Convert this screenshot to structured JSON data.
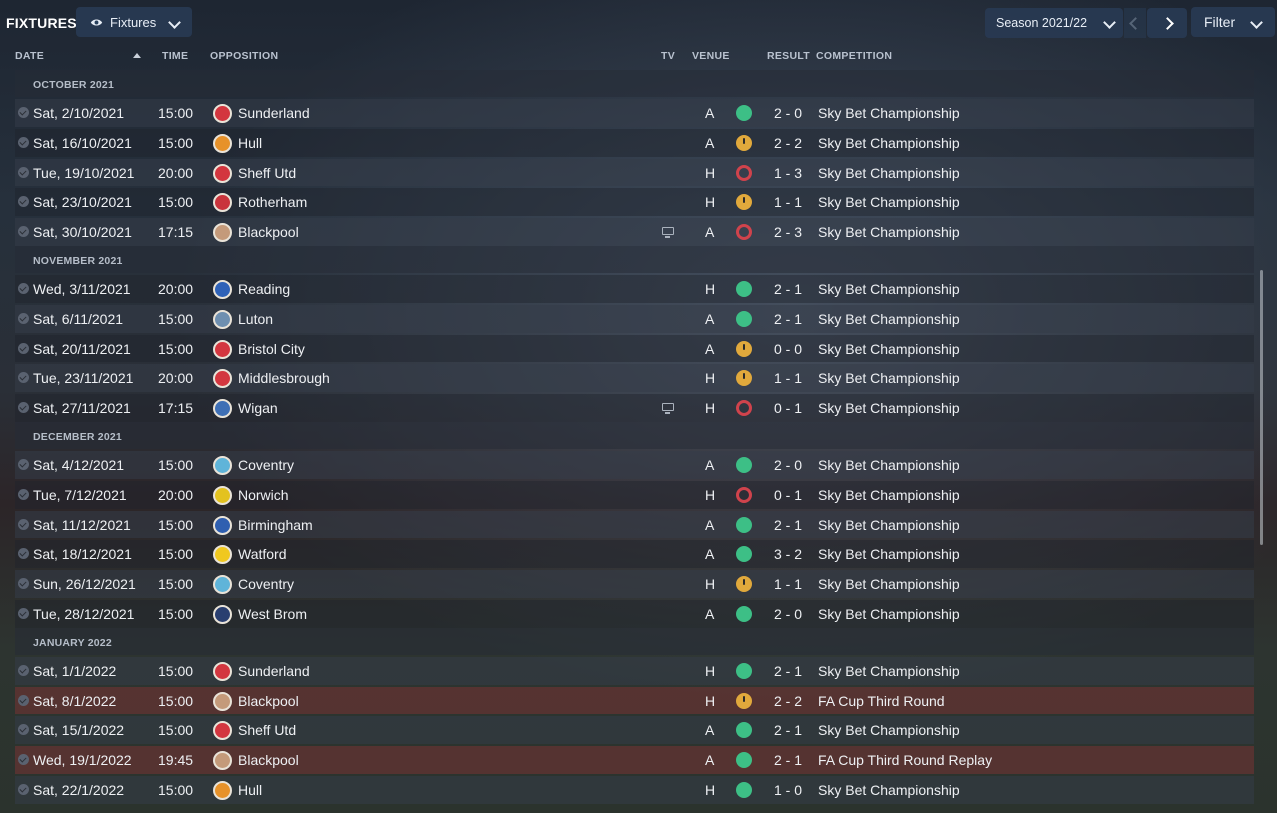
{
  "header": {
    "title": "FIXTURES",
    "view_button": "Fixtures",
    "season": "Season 2021/22",
    "filter": "Filter"
  },
  "columns": {
    "date": "DATE",
    "time": "TIME",
    "opposition": "OPPOSITION",
    "tv": "TV",
    "venue": "VENUE",
    "result": "RESULT",
    "competition": "COMPETITION"
  },
  "colors": {
    "win": "#3dbf86",
    "draw": "#e1a93c",
    "loss": "#d0434c",
    "cup_row": "#703434"
  },
  "groups": [
    {
      "month": "OCTOBER 2021",
      "fixtures": [
        {
          "date": "Sat, 2/10/2021",
          "time": "15:00",
          "opponent": "Sunderland",
          "badge_color": "#d3363f",
          "tv": false,
          "venue": "A",
          "outcome": "win",
          "result": "2 - 0",
          "competition": "Sky Bet Championship",
          "cup": false
        },
        {
          "date": "Sat, 16/10/2021",
          "time": "15:00",
          "opponent": "Hull",
          "badge_color": "#e7922a",
          "tv": false,
          "venue": "A",
          "outcome": "draw",
          "result": "2 - 2",
          "competition": "Sky Bet Championship",
          "cup": false
        },
        {
          "date": "Tue, 19/10/2021",
          "time": "20:00",
          "opponent": "Sheff Utd",
          "badge_color": "#d3363f",
          "tv": false,
          "venue": "H",
          "outcome": "loss",
          "result": "1 - 3",
          "competition": "Sky Bet Championship",
          "cup": false
        },
        {
          "date": "Sat, 23/10/2021",
          "time": "15:00",
          "opponent": "Rotherham",
          "badge_color": "#c9343c",
          "tv": false,
          "venue": "H",
          "outcome": "draw",
          "result": "1 - 1",
          "competition": "Sky Bet Championship",
          "cup": false
        },
        {
          "date": "Sat, 30/10/2021",
          "time": "17:15",
          "opponent": "Blackpool",
          "badge_color": "#c49a7a",
          "tv": true,
          "venue": "A",
          "outcome": "loss",
          "result": "2 - 3",
          "competition": "Sky Bet Championship",
          "cup": false
        }
      ]
    },
    {
      "month": "NOVEMBER 2021",
      "fixtures": [
        {
          "date": "Wed, 3/11/2021",
          "time": "20:00",
          "opponent": "Reading",
          "badge_color": "#2f62b8",
          "tv": false,
          "venue": "H",
          "outcome": "win",
          "result": "2 - 1",
          "competition": "Sky Bet Championship",
          "cup": false
        },
        {
          "date": "Sat, 6/11/2021",
          "time": "15:00",
          "opponent": "Luton",
          "badge_color": "#6e8fb0",
          "tv": false,
          "venue": "A",
          "outcome": "win",
          "result": "2 - 1",
          "competition": "Sky Bet Championship",
          "cup": false
        },
        {
          "date": "Sat, 20/11/2021",
          "time": "15:00",
          "opponent": "Bristol City",
          "badge_color": "#d3363f",
          "tv": false,
          "venue": "A",
          "outcome": "draw",
          "result": "0 - 0",
          "competition": "Sky Bet Championship",
          "cup": false
        },
        {
          "date": "Tue, 23/11/2021",
          "time": "20:00",
          "opponent": "Middlesbrough",
          "badge_color": "#d3363f",
          "tv": false,
          "venue": "H",
          "outcome": "draw",
          "result": "1 - 1",
          "competition": "Sky Bet Championship",
          "cup": false
        },
        {
          "date": "Sat, 27/11/2021",
          "time": "17:15",
          "opponent": "Wigan",
          "badge_color": "#3e6fb5",
          "tv": true,
          "venue": "H",
          "outcome": "loss",
          "result": "0 - 1",
          "competition": "Sky Bet Championship",
          "cup": false
        }
      ]
    },
    {
      "month": "DECEMBER 2021",
      "fixtures": [
        {
          "date": "Sat, 4/12/2021",
          "time": "15:00",
          "opponent": "Coventry",
          "badge_color": "#5fb4d9",
          "tv": false,
          "venue": "A",
          "outcome": "win",
          "result": "2 - 0",
          "competition": "Sky Bet Championship",
          "cup": false
        },
        {
          "date": "Tue, 7/12/2021",
          "time": "20:00",
          "opponent": "Norwich",
          "badge_color": "#e3c21f",
          "tv": false,
          "venue": "H",
          "outcome": "loss",
          "result": "0 - 1",
          "competition": "Sky Bet Championship",
          "cup": false
        },
        {
          "date": "Sat, 11/12/2021",
          "time": "15:00",
          "opponent": "Birmingham",
          "badge_color": "#2f5fb0",
          "tv": false,
          "venue": "A",
          "outcome": "win",
          "result": "2 - 1",
          "competition": "Sky Bet Championship",
          "cup": false
        },
        {
          "date": "Sat, 18/12/2021",
          "time": "15:00",
          "opponent": "Watford",
          "badge_color": "#f0c81f",
          "tv": false,
          "venue": "A",
          "outcome": "win",
          "result": "3 - 2",
          "competition": "Sky Bet Championship",
          "cup": false
        },
        {
          "date": "Sun, 26/12/2021",
          "time": "15:00",
          "opponent": "Coventry",
          "badge_color": "#5fb4d9",
          "tv": false,
          "venue": "H",
          "outcome": "draw",
          "result": "1 - 1",
          "competition": "Sky Bet Championship",
          "cup": false
        },
        {
          "date": "Tue, 28/12/2021",
          "time": "15:00",
          "opponent": "West Brom",
          "badge_color": "#2a3f70",
          "tv": false,
          "venue": "A",
          "outcome": "win",
          "result": "2 - 0",
          "competition": "Sky Bet Championship",
          "cup": false
        }
      ]
    },
    {
      "month": "JANUARY 2022",
      "fixtures": [
        {
          "date": "Sat, 1/1/2022",
          "time": "15:00",
          "opponent": "Sunderland",
          "badge_color": "#d3363f",
          "tv": false,
          "venue": "H",
          "outcome": "win",
          "result": "2 - 1",
          "competition": "Sky Bet Championship",
          "cup": false
        },
        {
          "date": "Sat, 8/1/2022",
          "time": "15:00",
          "opponent": "Blackpool",
          "badge_color": "#c49a7a",
          "tv": false,
          "venue": "H",
          "outcome": "draw",
          "result": "2 - 2",
          "competition": "FA Cup Third Round",
          "cup": true
        },
        {
          "date": "Sat, 15/1/2022",
          "time": "15:00",
          "opponent": "Sheff Utd",
          "badge_color": "#d3363f",
          "tv": false,
          "venue": "A",
          "outcome": "win",
          "result": "2 - 1",
          "competition": "Sky Bet Championship",
          "cup": false
        },
        {
          "date": "Wed, 19/1/2022",
          "time": "19:45",
          "opponent": "Blackpool",
          "badge_color": "#c49a7a",
          "tv": false,
          "venue": "A",
          "outcome": "win",
          "result": "2 - 1",
          "competition": "FA Cup Third Round Replay",
          "cup": true
        },
        {
          "date": "Sat, 22/1/2022",
          "time": "15:00",
          "opponent": "Hull",
          "badge_color": "#e7922a",
          "tv": false,
          "venue": "H",
          "outcome": "win",
          "result": "1 - 0",
          "competition": "Sky Bet Championship",
          "cup": false
        }
      ]
    }
  ]
}
